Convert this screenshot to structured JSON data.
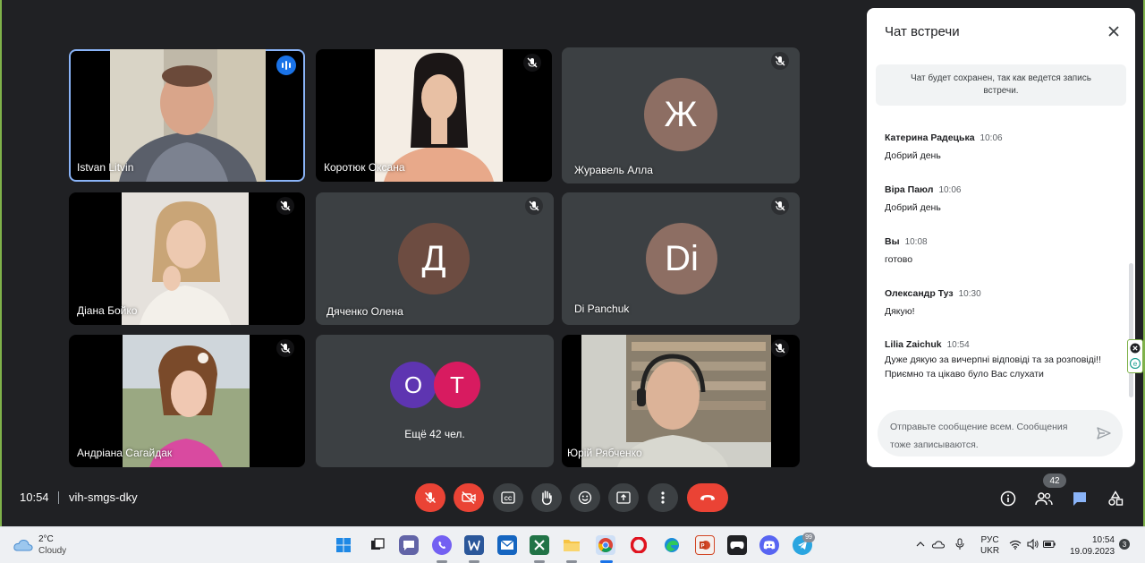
{
  "tiles": [
    {
      "name": "Istvan Litvin",
      "muted": false,
      "speaking": true
    },
    {
      "name": "Коротюк Оксана",
      "muted": true
    },
    {
      "name": "Журавель Алла",
      "muted": true,
      "initial": "Ж",
      "avatar_color": "#8d6e63"
    },
    {
      "name": "Діана Бойко",
      "muted": true
    },
    {
      "name": "Дяченко Олена",
      "muted": true,
      "initial": "Д",
      "avatar_color": "#6d4c41"
    },
    {
      "name": "Di Panchuk",
      "muted": true,
      "initial": "Di",
      "avatar_color": "#8d6e63"
    },
    {
      "name": "Андріана Сагайдак",
      "muted": true
    },
    {
      "others": "Ещё 42 чел.",
      "avatars": [
        {
          "initial": "О",
          "color": "#5e35b1"
        },
        {
          "initial": "Т",
          "color": "#d81b60"
        }
      ]
    },
    {
      "name": "Юрій Рябченко",
      "muted": true
    }
  ],
  "chat": {
    "title": "Чат встречи",
    "notice": "Чат будет сохранен, так как ведется запись встречи.",
    "messages": [
      {
        "author": "Катерина Радецька",
        "time": "10:06",
        "text": "Добрий день"
      },
      {
        "author": "Віра Паюл",
        "time": "10:06",
        "text": "Добрий день"
      },
      {
        "author": "Вы",
        "time": "10:08",
        "text": "готово"
      },
      {
        "author": "Олександр Туз",
        "time": "10:30",
        "text": "Дякую!"
      },
      {
        "author": "Lilia Zaichuk",
        "time": "10:54",
        "text": "Дуже дякую за вичерпні відповіді та за розповіді!! Приємно та цікаво було Вас слухати"
      }
    ],
    "input_placeholder": "Отправьте сообщение всем. Сообщения тоже записываются."
  },
  "meeting": {
    "time": "10:54",
    "code": "vih-smgs-dky",
    "participant_count": "42"
  },
  "taskbar": {
    "weather_temp": "2°C",
    "weather_desc": "Cloudy",
    "lang_line1": "РУС",
    "lang_line2": "UKR",
    "time": "10:54",
    "date": "19.09.2023",
    "notification_count": "3",
    "telegram_badge": "99"
  },
  "colors": {
    "meet_bg": "#202124",
    "tile_bg": "#3c4043",
    "red": "#ea4335",
    "blue": "#1a73e8",
    "desktop": "#7fb24a"
  }
}
